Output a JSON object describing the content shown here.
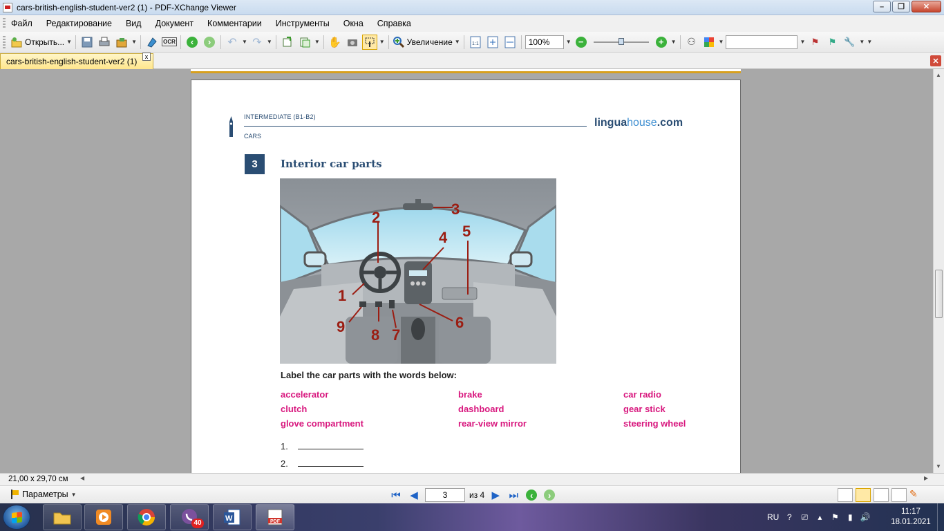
{
  "window": {
    "title": "cars-british-english-student-ver2 (1) - PDF-XChange Viewer",
    "min_label": "–",
    "max_label": "❐",
    "close_label": "✕"
  },
  "menu": [
    "Файл",
    "Редактирование",
    "Вид",
    "Документ",
    "Комментарии",
    "Инструменты",
    "Окна",
    "Справка"
  ],
  "toolbar": {
    "open_label": "Открыть...",
    "zoom_label": "Увеличение",
    "zoom_value": "100%",
    "ocr_label": "OCR",
    "search_value": "",
    "zoom_slider_level": 0.5
  },
  "tab": {
    "label": "cars-british-english-student-ver2 (1)",
    "close_label": "x"
  },
  "page": {
    "level": "INTERMEDIATE (B1-B2)",
    "topic": "CARS",
    "brand_bold": "lingua",
    "brand_light": "house",
    "brand_tld": ".com",
    "section_number": "3",
    "section_title": "Interior car parts",
    "instruction": "Label the car parts with the words below:",
    "words": [
      [
        "accelerator",
        "brake",
        "car radio"
      ],
      [
        "clutch",
        "dashboard",
        "gear stick"
      ],
      [
        "glove compartment",
        "rear-view mirror",
        "steering wheel"
      ]
    ],
    "answers": [
      "1.",
      "2."
    ],
    "callouts": [
      "1",
      "2",
      "3",
      "4",
      "5",
      "6",
      "7",
      "8",
      "9"
    ]
  },
  "status": {
    "page_size": "21,00 x 29,70 см"
  },
  "bottom": {
    "params_label": "Параметры",
    "current_page": "3",
    "of_pages": "из 4"
  },
  "taskbar": {
    "lang": "RU",
    "time": "11:17",
    "date": "18.01.2021",
    "viber_badge": "40",
    "word_label": "W",
    "pdf_label": "PDF"
  },
  "colors": {
    "accent_blue": "#2a4d73",
    "word_pink": "#d8177e",
    "callout_red": "#9b1d12",
    "tab_yellow": "#ffe68c"
  },
  "icons": [
    "open-icon",
    "save-icon",
    "print-icon",
    "back-green-icon",
    "forward-green-icon",
    "undo-icon",
    "redo-icon",
    "hand-tool-icon",
    "snapshot-icon",
    "select-text-icon",
    "zoom-icon",
    "zoom-out-icon",
    "zoom-in-icon",
    "binoculars-icon",
    "google-icon",
    "first-page-icon",
    "prev-page-icon",
    "next-page-icon",
    "last-page-icon"
  ]
}
